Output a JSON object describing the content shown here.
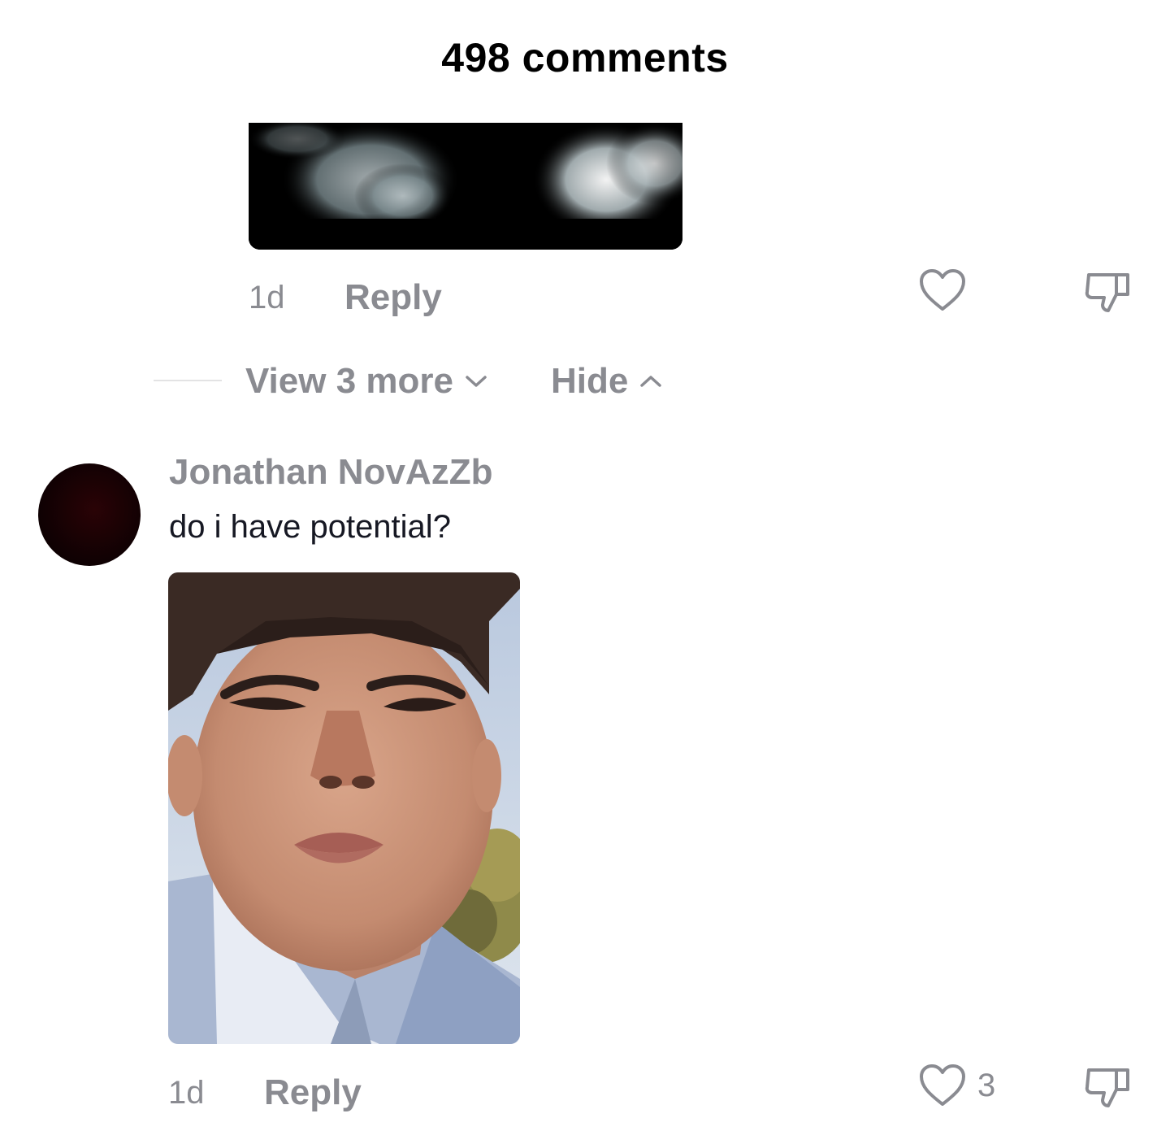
{
  "header": {
    "title": "498 comments"
  },
  "reply_above": {
    "time": "1d",
    "reply_label": "Reply",
    "like_icon": "heart-outline-icon",
    "dislike_icon": "thumbs-down-icon"
  },
  "thread_controls": {
    "view_more_label": "View 3 more",
    "hide_label": "Hide"
  },
  "comment": {
    "username": "Jonathan NovAzZb",
    "text": "do i have potential?",
    "time": "1d",
    "reply_label": "Reply",
    "like_count": "3",
    "like_icon": "heart-outline-icon",
    "dislike_icon": "thumbs-down-icon"
  },
  "colors": {
    "muted": "#8a8b91",
    "text": "#161823",
    "background": "#ffffff"
  }
}
